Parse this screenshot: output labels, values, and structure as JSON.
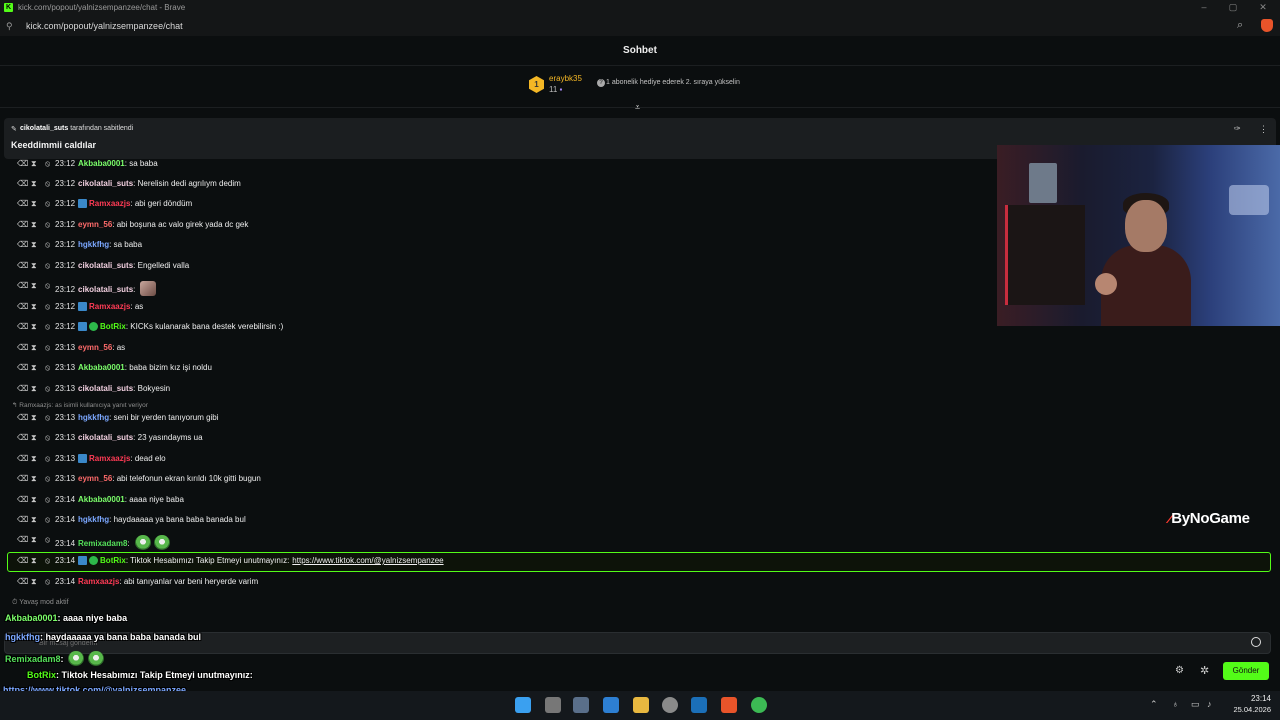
{
  "browser": {
    "title": "kick.com/popout/yalnizsempanzee/chat - Brave",
    "url": "kick.com/popout/yalnizsempanzee/chat"
  },
  "header": {
    "title": "Sohbet"
  },
  "leaderboard": {
    "rank": "1",
    "name": "eraybk35",
    "count": "11",
    "gift_message": "1 abonelik hediye ederek 2. sıraya yükselin"
  },
  "pinned": {
    "by_user": "cikolatali_suts",
    "by_suffix": "tarafından sabitlendi",
    "text": "Keeddimmii caldılar"
  },
  "messages": [
    {
      "time": "23:12",
      "user": "Akbaba0001",
      "color": "#7cff6b",
      "text": "sa baba"
    },
    {
      "time": "23:12",
      "user": "cikolatali_suts",
      "color": "#f2d0e0",
      "text": "Nerelisin dedi agrılıym dedim"
    },
    {
      "time": "23:12",
      "user": "Ramxaazjs",
      "color": "#ff3b55",
      "text": "abi geri döndüm",
      "badge": "blue"
    },
    {
      "time": "23:12",
      "user": "eymn_56",
      "color": "#ff6b6b",
      "text": "abi boşuna ac valo girek yada dc gek"
    },
    {
      "time": "23:12",
      "user": "hgkkfhg",
      "color": "#7ba7ff",
      "text": "sa baba"
    },
    {
      "time": "23:12",
      "user": "cikolatali_suts",
      "color": "#f2d0e0",
      "text": "Engelledi valla"
    },
    {
      "time": "23:12",
      "user": "cikolatali_suts",
      "color": "#f2d0e0",
      "text": "",
      "emote": "cat"
    },
    {
      "time": "23:12",
      "user": "Ramxaazjs",
      "color": "#ff3b55",
      "text": "as",
      "badge": "blue"
    },
    {
      "time": "23:12",
      "user": "BotRix",
      "color": "#53fc18",
      "text": "KICKs kulanarak bana destek verebilirsin :)",
      "badge": "bot"
    },
    {
      "time": "23:13",
      "user": "eymn_56",
      "color": "#ff6b6b",
      "text": "as"
    },
    {
      "time": "23:13",
      "user": "Akbaba0001",
      "color": "#7cff6b",
      "text": "baba bizim kız işi noldu"
    },
    {
      "time": "23:13",
      "user": "cikolatali_suts",
      "color": "#f2d0e0",
      "text": "Bokyesin"
    },
    {
      "time": "23:13",
      "user": "hgkkfhg",
      "color": "#7ba7ff",
      "text": "seni bir yerden tanıyorum gibi"
    },
    {
      "time": "23:13",
      "user": "cikolatali_suts",
      "color": "#f2d0e0",
      "text": "23 yasındayms ua"
    },
    {
      "time": "23:13",
      "user": "Ramxaazjs",
      "color": "#ff3b55",
      "text": "dead elo",
      "badge": "blue"
    },
    {
      "time": "23:13",
      "user": "eymn_56",
      "color": "#ff6b6b",
      "text": "abi telefonun ekran kırıldı 10k gitti bugun"
    },
    {
      "time": "23:14",
      "user": "Akbaba0001",
      "color": "#7cff6b",
      "text": "aaaa niye baba"
    },
    {
      "time": "23:14",
      "user": "hgkkfhg",
      "color": "#7ba7ff",
      "text": "haydaaaaa ya bana baba banada bul"
    },
    {
      "time": "23:14",
      "user": "Remixadam8",
      "color": "#55e05a",
      "text": "",
      "emote": "frog2"
    },
    {
      "time": "23:14",
      "user": "BotRix",
      "color": "#53fc18",
      "text": "Tiktok Hesabımızı Takip Etmeyi unutmayınız:",
      "link": "https://www.tiktok.com/@yalnizsempanzee",
      "badge": "bot"
    },
    {
      "time": "23:14",
      "user": "Ramxaazjs",
      "color": "#ff3b55",
      "text": "abi tanıyanlar var beni heryerde varim"
    }
  ],
  "reply_note": "Ramxaazjs: as isimli kullanıcıya yanıt veriyor",
  "slow_mode": "Yavaş mod aktif",
  "input": {
    "placeholder": "Bir mesaj gönderin"
  },
  "send_label": "Gönder",
  "overlay": [
    {
      "user": "Akbaba0001",
      "color": "#7cff6b",
      "text": ": aaaa niye baba"
    },
    {
      "user": "hgkkfhg",
      "color": "#7ba7ff",
      "text": ": haydaaaaa ya bana baba banada bul"
    },
    {
      "user": "Remixadam8",
      "color": "#55e05a",
      "text": ":"
    },
    {
      "user": "BotRix",
      "color": "#53fc18",
      "text": ": Tiktok Hesabımızı Takip Etmeyi unutmayınız:"
    },
    {
      "user": "",
      "color": "#7ba7ff",
      "text": "https://www.tiktok.com/@yalnizsempanzee"
    },
    {
      "user": "Ramxaazjs",
      "color": "#ff3b55",
      "text": ": abi tanıyanlar var beni heryerde varim"
    }
  ],
  "watermark": {
    "mark": "⁄",
    "text": "ByNoGame"
  },
  "taskbar": {
    "time": "23:14",
    "date": "25.04.2026"
  },
  "colors": {
    "accent": "#53fc18",
    "leader_gold": "#f4b725"
  },
  "icons": [
    "kick-logo-icon",
    "tune-icon",
    "zoom-icon",
    "brave-icon",
    "trash-icon",
    "timeout-icon",
    "ban-icon",
    "pin-icon",
    "more-icon",
    "emoji-icon",
    "settings-icon",
    "gift-icon",
    "windows-icon"
  ]
}
